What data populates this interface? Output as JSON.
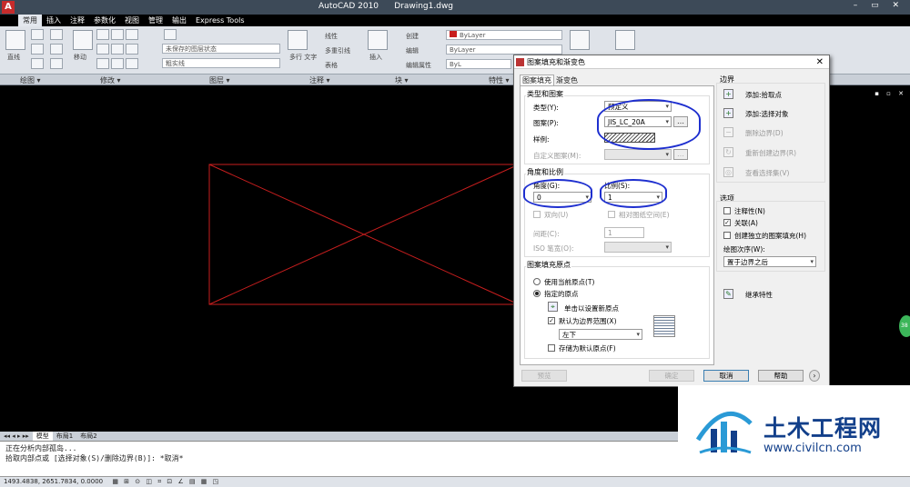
{
  "window": {
    "app_title": "AutoCAD 2010",
    "document_title": "Drawing1.dwg",
    "controls": "–  ▭  ✕"
  },
  "menu_tabs": [
    "常用",
    "插入",
    "注释",
    "参数化",
    "视图",
    "管理",
    "输出",
    "Express Tools"
  ],
  "ribbon": {
    "draw": {
      "line_label": "直线"
    },
    "modify": {
      "move_label": "移动"
    },
    "layer": {
      "state_dropdown": "未保存的图层状态",
      "layer_dropdown": "粗实线"
    },
    "annotation": {
      "text_label": "多行\n文字",
      "linear": "线性",
      "multileader": "多重引线",
      "table": "表格"
    },
    "block": {
      "insert_label": "插入",
      "create": "创建",
      "edit": "编辑",
      "edit_attr": "编辑属性"
    },
    "properties": {
      "color": "ByLayer",
      "linetype": "ByLayer",
      "lineweight": "ByL"
    },
    "panels": [
      "绘图 ▾",
      "修改 ▾",
      "图层 ▾",
      "注释 ▾",
      "块 ▾",
      "特性 ▾"
    ]
  },
  "canvas": {
    "controls": "▪ ▫ ✕"
  },
  "layout_tabs": [
    "模型",
    "布局1",
    "布局2"
  ],
  "command_line": {
    "line1": "正在分析内部孤岛...",
    "line2": "拾取内部点或 [选择对象(S)/删除边界(B)]:  *取消*"
  },
  "status": {
    "coords": "1493.4838, 2651.7834, 0.0000"
  },
  "dialog": {
    "title": "图案填充和渐变色",
    "tabs": [
      "图案填充",
      "渐变色"
    ],
    "type_and_pattern": {
      "group_label": "类型和图案",
      "type_label": "类型(Y):",
      "type_value": "预定义",
      "pattern_label": "图案(P):",
      "pattern_value": "JIS_LC_20A",
      "sample_label": "样例:",
      "custom_label": "自定义图案(M):"
    },
    "angle_scale": {
      "group_label": "角度和比例",
      "angle_label": "角度(G):",
      "angle_value": "0",
      "scale_label": "比例(S):",
      "scale_value": "1",
      "double_label": "双向(U)",
      "relative_label": "相对图纸空间(E)",
      "spacing_label": "间距(C):",
      "spacing_value": "1",
      "iso_label": "ISO 笔宽(O):"
    },
    "origin": {
      "group_label": "图案填充原点",
      "use_current": "使用当前原点(T)",
      "specified": "指定的原点",
      "click_set": "单击以设置新原点",
      "default_extents": "默认为边界范围(X)",
      "position_value": "左下",
      "store_default": "存储为默认原点(F)"
    },
    "boundary": {
      "group_label": "边界",
      "add_pick": "添加:拾取点",
      "add_select": "添加:选择对象",
      "remove": "删除边界(D)",
      "recreate": "重新创建边界(R)",
      "view_selection": "查看选择集(V)"
    },
    "options": {
      "group_label": "选项",
      "annotative": "注释性(N)",
      "associative": "关联(A)",
      "separate": "创建独立的图案填充(H)",
      "draw_order_label": "绘图次序(W):",
      "draw_order_value": "置于边界之后"
    },
    "inherit": "继承特性",
    "buttons": {
      "preview": "预览",
      "ok": "确定",
      "cancel": "取消",
      "help": "帮助",
      "more": "›"
    }
  },
  "watermark": {
    "name_cn": "土木工程网",
    "url": "www.civilcn.com"
  },
  "colors": {
    "annotation_ink": "#1e2fcf",
    "drawing_red": "#c81e1e",
    "brand_blue": "#123f8a"
  }
}
